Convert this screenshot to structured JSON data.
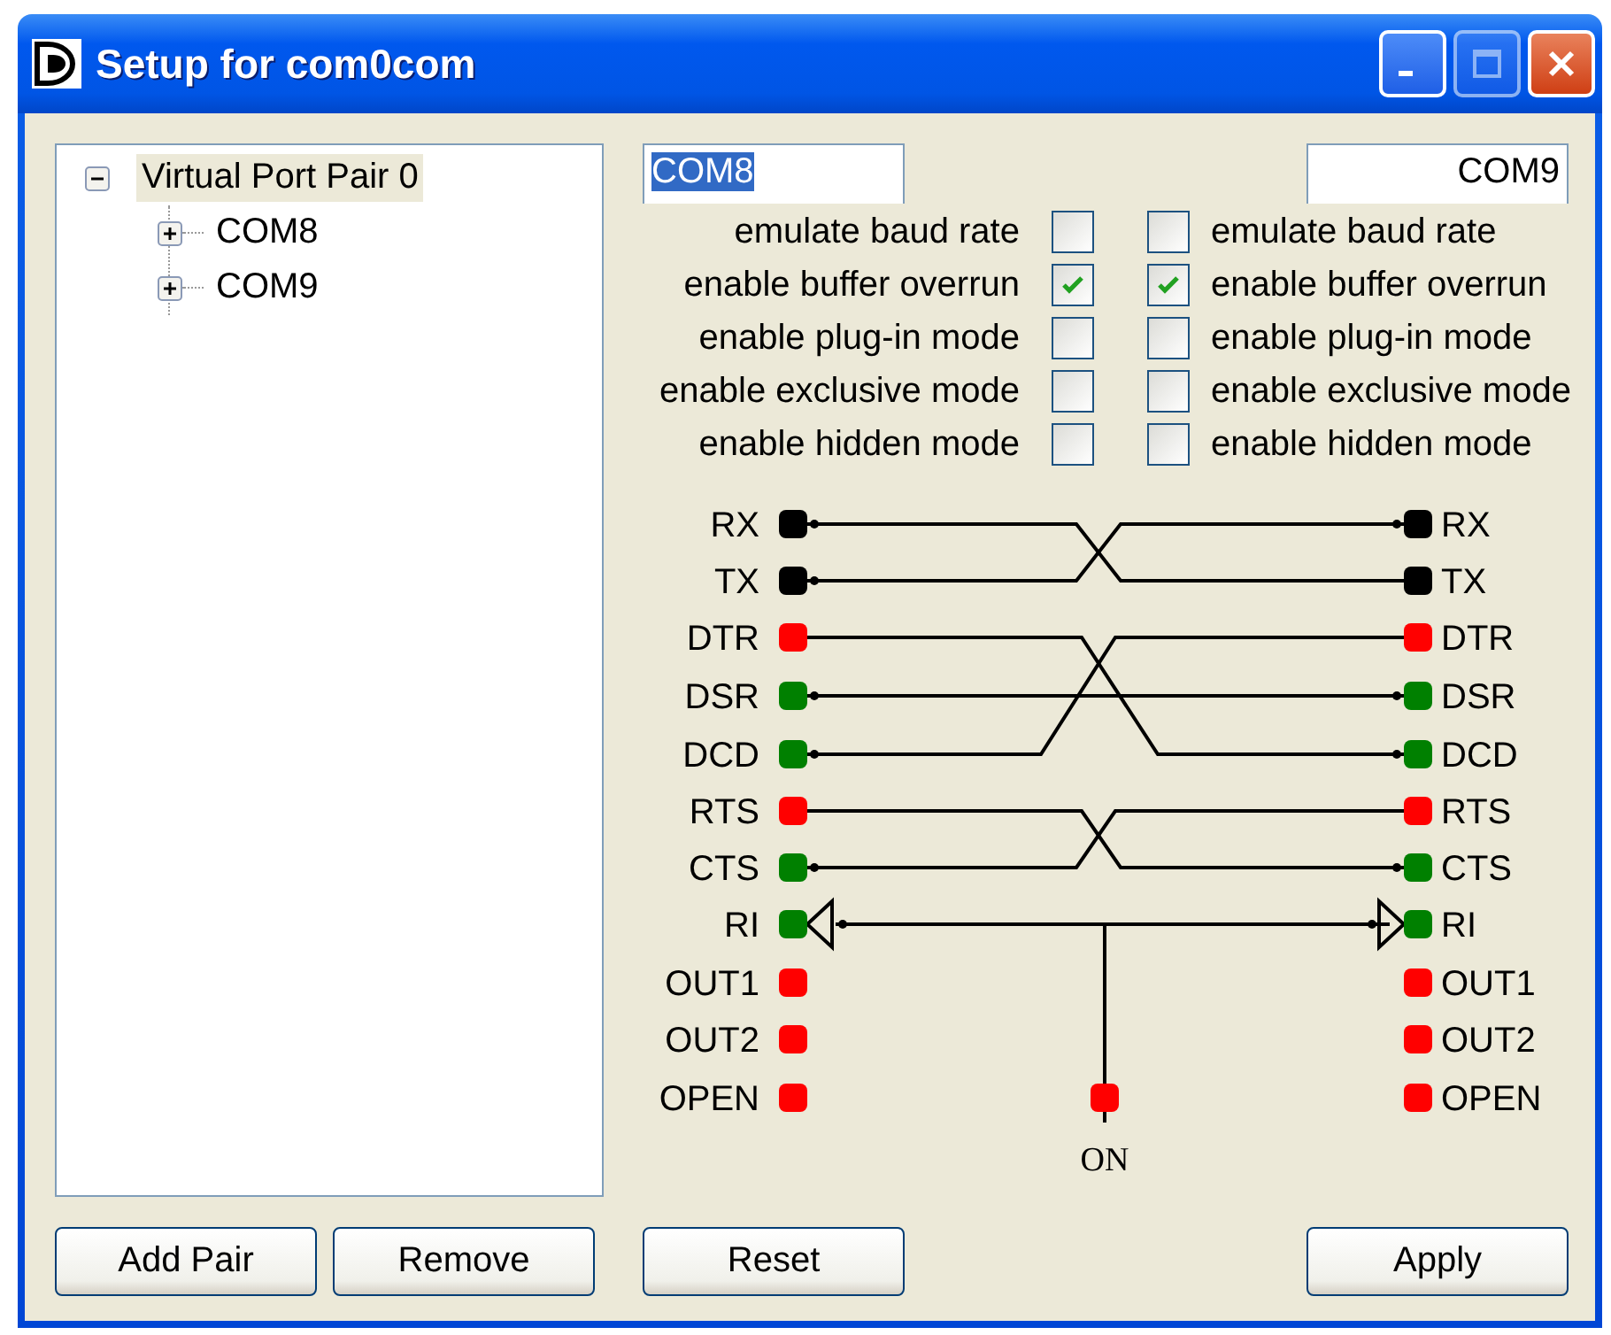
{
  "window": {
    "title": "Setup for com0com",
    "maximize_disabled": true
  },
  "tree": [
    {
      "label": "Virtual Port Pair 0",
      "expanded": true,
      "selected": true,
      "children": [
        {
          "label": "COM8",
          "expanded": false,
          "selected": false
        },
        {
          "label": "COM9",
          "expanded": false,
          "selected": false
        }
      ]
    }
  ],
  "ports": [
    {
      "name": "COM8",
      "text_selected": true,
      "options": [
        {
          "label": "emulate baud rate",
          "checked": false
        },
        {
          "label": "enable buffer overrun",
          "checked": true
        },
        {
          "label": "enable plug-in mode",
          "checked": false
        },
        {
          "label": "enable exclusive mode",
          "checked": false
        },
        {
          "label": "enable hidden mode",
          "checked": false
        }
      ]
    },
    {
      "name": "COM9",
      "text_selected": false,
      "options": [
        {
          "label": "emulate baud rate",
          "checked": false
        },
        {
          "label": "enable buffer overrun",
          "checked": true
        },
        {
          "label": "enable plug-in mode",
          "checked": false
        },
        {
          "label": "enable exclusive mode",
          "checked": false
        },
        {
          "label": "enable hidden mode",
          "checked": false
        }
      ]
    }
  ],
  "left_pins": [
    {
      "label": "RX",
      "color": "#000000"
    },
    {
      "label": "TX",
      "color": "#000000"
    },
    {
      "label": "DTR",
      "color": "#ff0000"
    },
    {
      "label": "DSR",
      "color": "#008000"
    },
    {
      "label": "DCD",
      "color": "#008000"
    },
    {
      "label": "RTS",
      "color": "#ff0000"
    },
    {
      "label": "CTS",
      "color": "#008000"
    },
    {
      "label": "RI",
      "color": "#008000"
    },
    {
      "label": "OUT1",
      "color": "#ff0000"
    },
    {
      "label": "OUT2",
      "color": "#ff0000"
    },
    {
      "label": "OPEN",
      "color": "#ff0000"
    }
  ],
  "right_pins": [
    {
      "label": "RX",
      "color": "#000000"
    },
    {
      "label": "TX",
      "color": "#000000"
    },
    {
      "label": "DTR",
      "color": "#ff0000"
    },
    {
      "label": "DSR",
      "color": "#008000"
    },
    {
      "label": "DCD",
      "color": "#008000"
    },
    {
      "label": "RTS",
      "color": "#ff0000"
    },
    {
      "label": "CTS",
      "color": "#008000"
    },
    {
      "label": "RI",
      "color": "#008000"
    },
    {
      "label": "OUT1",
      "color": "#ff0000"
    },
    {
      "label": "OUT2",
      "color": "#ff0000"
    },
    {
      "label": "OPEN",
      "color": "#ff0000"
    }
  ],
  "on_pin": {
    "label": "ON",
    "color": "#ff0000"
  },
  "left_buttons": [
    "Add Pair",
    "Remove"
  ],
  "right_buttons": [
    "Reset",
    "Apply"
  ]
}
